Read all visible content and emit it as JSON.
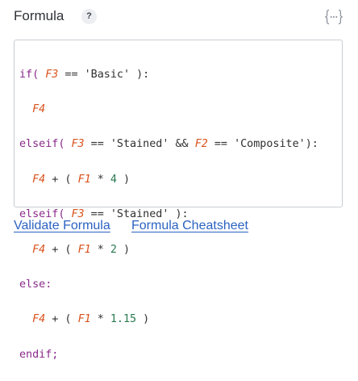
{
  "header": {
    "title": "Formula",
    "help_badge": "?",
    "format_icon": "curly-braces-icon"
  },
  "editor": {
    "code": {
      "line1": {
        "kw1": "if(",
        "var1": "F3",
        "op1": " == ",
        "str1": "'Basic'",
        "op2": " ):"
      },
      "line2": {
        "var1": "F4"
      },
      "line3": {
        "kw1": "elseif(",
        "var1": "F3",
        "op1": " == ",
        "str1": "'Stained'",
        "op2": " && ",
        "var2": "F2",
        "op3": " == ",
        "str2": "'Composite'",
        "op4": "):"
      },
      "line4": {
        "var1": "F4",
        "op1": " + ( ",
        "var2": "F1",
        "op2": " * ",
        "num1": "4",
        "op3": " )"
      },
      "line5": {
        "kw1": "elseif(",
        "var1": "F3",
        "op1": " == ",
        "str1": "'Stained'",
        "op2": " ):"
      },
      "line6": {
        "var1": "F4",
        "op1": " + ( ",
        "var2": "F1",
        "op2": " * ",
        "num1": "2",
        "op3": " )"
      },
      "line7": {
        "kw1": "else:"
      },
      "line8": {
        "var1": "F4",
        "op1": " + ( ",
        "var2": "F1",
        "op2": " * ",
        "num1": "1.15",
        "op3": " )"
      },
      "line9": {
        "kw1": "endif;"
      }
    }
  },
  "links": {
    "validate": "Validate Formula",
    "cheatsheet": "Formula Cheatsheet"
  },
  "colors": {
    "keyword": "#8a2a8a",
    "variable": "#d9531e",
    "number": "#2a7a50",
    "link": "#2b62c1"
  }
}
